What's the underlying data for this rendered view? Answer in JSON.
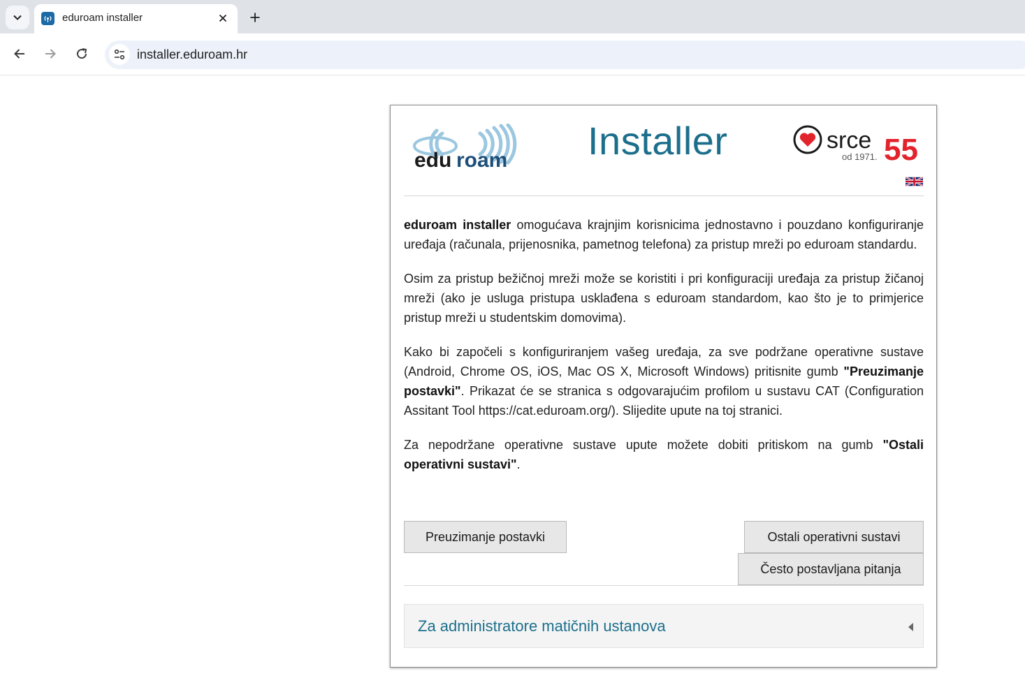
{
  "browser": {
    "tab_title": "eduroam installer",
    "url": "installer.eduroam.hr",
    "icons": {
      "tab_search": "chevron-down-icon",
      "favicon": "eduroam-favicon",
      "tab_close": "close-icon",
      "new_tab": "plus-icon",
      "back": "arrow-left-icon",
      "forward": "arrow-right-icon",
      "reload": "reload-icon",
      "site_info": "tune-icon"
    }
  },
  "header": {
    "title": "Installer",
    "logo_eduroam": {
      "text_edu": "edu",
      "text_roam": "roam"
    },
    "logo_srce": {
      "text": "srce",
      "number": "55",
      "since": "od 1971."
    },
    "language_flag": "uk-flag-icon"
  },
  "content": {
    "p1_bold": "eduroam installer",
    "p1_text": " omogućava krajnjim korisnicima jednostavno i pouzdano konfiguriranje uređaja (računala, prijenosnika, pametnog telefona) za pristup mreži po eduroam standardu.",
    "p2_text": "Osim za pristup bežičnoj mreži može se koristiti i pri konfiguraciji uređaja za pristup žičanoj mreži (ako je usluga pristupa usklađena s eduroam standardom, kao što je to primjerice pristup mreži u studentskim domovima).",
    "p3_text_a": "Kako bi započeli s konfiguriranjem vašeg uređaja, za sve podržane operativne sustave (Android, Chrome OS, iOS, Mac OS X, Microsoft Windows) pritisnite gumb ",
    "p3_bold": "\"Preuzimanje postavki\"",
    "p3_text_b": ". Prikazat će se stranica s odgovarajućim profilom u sustavu CAT (Configuration Assitant Tool https://cat.eduroam.org/). Slijedite upute na toj stranici.",
    "p4_text_a": "Za nepodržane operativne sustave upute možete dobiti pritiskom na gumb ",
    "p4_bold": "\"Ostali operativni sustavi\"",
    "p4_text_b": "."
  },
  "buttons": {
    "download": "Preuzimanje postavki",
    "other_os": "Ostali operativni sustavi",
    "faq": "Često postavljana pitanja"
  },
  "admin_panel": {
    "label": "Za administratore matičnih ustanova"
  },
  "colors": {
    "accent": "#1c6f8c",
    "srce_red": "#e3232c",
    "eduroam_blue": "#9bc7e0"
  }
}
